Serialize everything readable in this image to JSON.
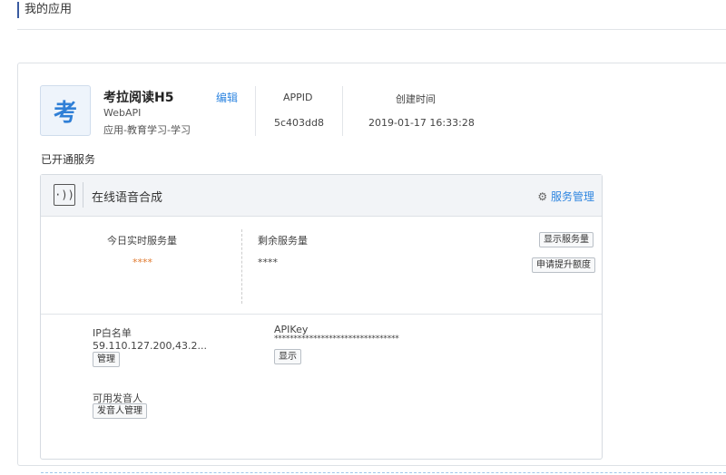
{
  "page": {
    "title": "我的应用"
  },
  "app": {
    "avatar_char": "考",
    "name": "考拉阅读H5",
    "platform": "WebAPI",
    "category": "应用-教育学习-学习",
    "edit_label": "编辑",
    "appid_label": "APPID",
    "appid_value": "5c403dd8",
    "created_label": "创建时间",
    "created_value": "2019-01-17 16:33:28"
  },
  "services_section_label": "已开通服务",
  "service": {
    "icon": "voice-synthesis-icon",
    "icon_glyph": "·))",
    "name": "在线语音合成",
    "manage_label": "服务管理",
    "manage_icon": "gear-icon",
    "usage": {
      "today_label": "今日实时服务量",
      "today_value": "****",
      "remaining_label": "剩余服务量",
      "remaining_value": "****",
      "show_button": "显示服务量",
      "apply_button": "申请提升额度"
    },
    "ip_whitelist": {
      "label": "IP白名单",
      "value": "59.110.127.200,43.2...",
      "manage_button": "管理"
    },
    "apikey": {
      "label": "APIKey",
      "value": "********************************",
      "show_button": "显示"
    },
    "voices": {
      "label": "可用发音人",
      "manage_button": "发音人管理"
    }
  },
  "colors": {
    "link": "#2f86e0",
    "accent_orange": "#e07a2f",
    "title_bar": "#3a5ba0"
  }
}
